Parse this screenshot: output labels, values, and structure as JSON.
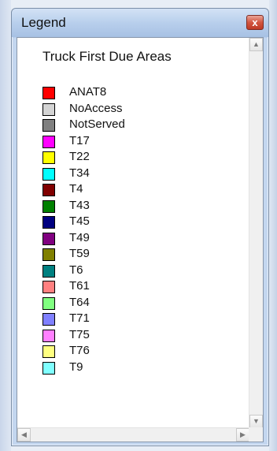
{
  "window": {
    "title": "Legend",
    "close_glyph": "x",
    "close_color": "#c8412a"
  },
  "legend": {
    "title": "Truck First Due Areas",
    "items": [
      {
        "label": "ANAT8",
        "color": "#ff0000"
      },
      {
        "label": "NoAccess",
        "color": "#d4d4d4"
      },
      {
        "label": "NotServed",
        "color": "#808080"
      },
      {
        "label": "T17",
        "color": "#ff00ff"
      },
      {
        "label": "T22",
        "color": "#ffff00"
      },
      {
        "label": "T34",
        "color": "#00ffff"
      },
      {
        "label": "T4",
        "color": "#800000"
      },
      {
        "label": "T43",
        "color": "#008000"
      },
      {
        "label": "T45",
        "color": "#000080"
      },
      {
        "label": "T49",
        "color": "#800080"
      },
      {
        "label": "T59",
        "color": "#808000"
      },
      {
        "label": "T6",
        "color": "#008080"
      },
      {
        "label": "T61",
        "color": "#ff8080"
      },
      {
        "label": "T64",
        "color": "#80ff80"
      },
      {
        "label": "T71",
        "color": "#8080ff"
      },
      {
        "label": "T75",
        "color": "#ff80ff"
      },
      {
        "label": "T76",
        "color": "#ffff80"
      },
      {
        "label": "T9",
        "color": "#80ffff"
      }
    ]
  },
  "scrollbars": {
    "up_icon": "up-arrow-icon",
    "down_icon": "down-arrow-icon",
    "left_icon": "left-arrow-icon",
    "right_icon": "right-arrow-icon"
  }
}
